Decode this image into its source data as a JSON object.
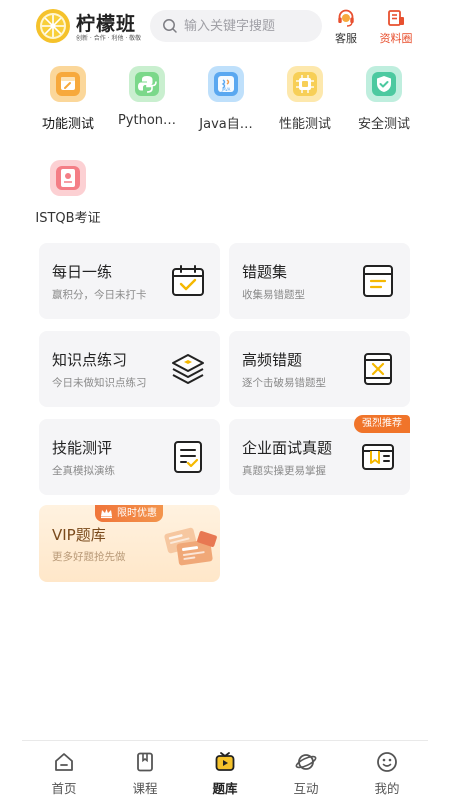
{
  "header": {
    "logo_title": "柠檬班",
    "logo_subtitle": "创新 · 合作 · 利他 · 敬敬",
    "search_placeholder": "输入关键字搜题",
    "service_label": "客服",
    "resources_label": "资料圈"
  },
  "categories": [
    {
      "label": "功能测试",
      "icon": "wrench-calendar-icon",
      "color": "#f7a93c"
    },
    {
      "label": "Python…",
      "icon": "python-icon",
      "color": "#6fcf7f"
    },
    {
      "label": "Java自…",
      "icon": "java-icon",
      "color": "#5aa8f0"
    },
    {
      "label": "性能测试",
      "icon": "chip-icon",
      "color": "#f7c94e"
    },
    {
      "label": "安全测试",
      "icon": "shield-check-icon",
      "color": "#4cc9a0"
    },
    {
      "label": "ISTQB考证",
      "icon": "certificate-icon",
      "color": "#f47e86"
    }
  ],
  "cards": [
    {
      "title": "每日一练",
      "subtitle": "赢积分，今日未打卡",
      "icon": "calendar-check-icon"
    },
    {
      "title": "错题集",
      "subtitle": "收集易错题型",
      "icon": "notebook-icon"
    },
    {
      "title": "知识点练习",
      "subtitle": "今日未做知识点练习",
      "icon": "layers-icon"
    },
    {
      "title": "高频错题",
      "subtitle": "逐个击破易错题型",
      "icon": "book-x-icon"
    },
    {
      "title": "技能测评",
      "subtitle": "全真模拟演练",
      "icon": "clipboard-check-icon"
    },
    {
      "title": "企业面试真题",
      "subtitle": "真题实操更易掌握",
      "icon": "bookmark-book-icon",
      "badge": "强烈推荐"
    }
  ],
  "vip": {
    "title": "VIP题库",
    "subtitle": "更多好题抢先做",
    "tag": "限时优惠"
  },
  "tabs": [
    {
      "label": "首页",
      "icon": "home-icon"
    },
    {
      "label": "课程",
      "icon": "course-book-icon"
    },
    {
      "label": "题库",
      "icon": "question-bank-icon",
      "active": true
    },
    {
      "label": "互动",
      "icon": "planet-icon"
    },
    {
      "label": "我的",
      "icon": "smile-face-icon"
    }
  ],
  "colors": {
    "accent": "#f0742a",
    "brand_yellow": "#f5c22b",
    "resources_red": "#e8502f",
    "card_bg": "#f5f5f7"
  }
}
